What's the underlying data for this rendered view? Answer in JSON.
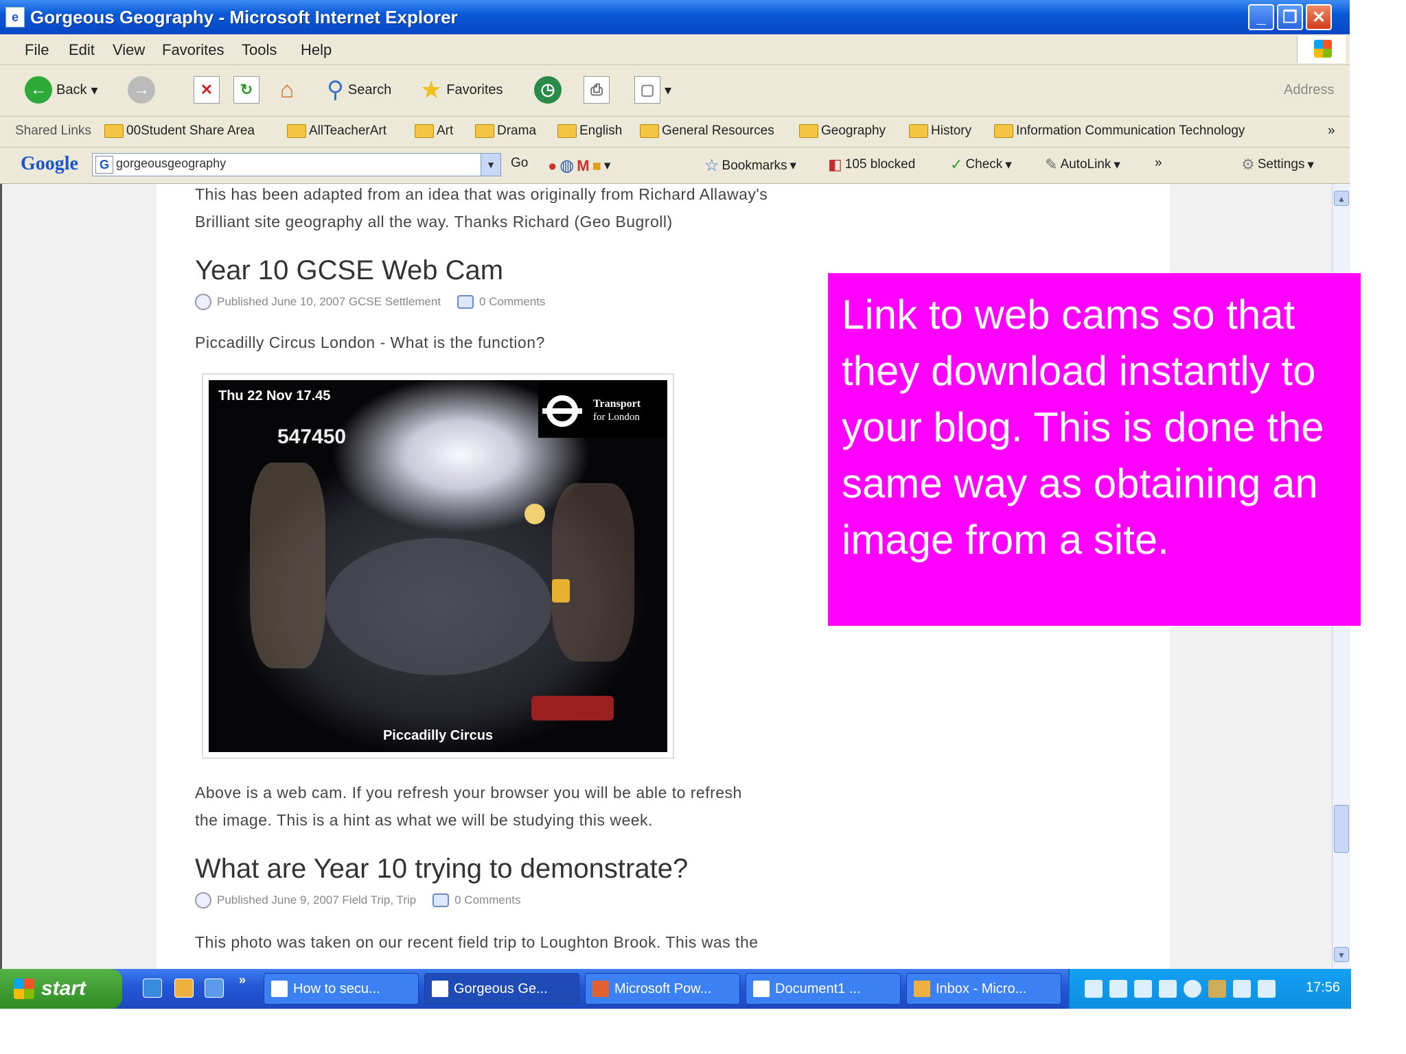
{
  "window": {
    "title": "Gorgeous Geography - Microsoft Internet Explorer",
    "min_label": "_",
    "max_label": "❐",
    "close_label": "✕"
  },
  "menu": [
    "File",
    "Edit",
    "View",
    "Favorites",
    "Tools",
    "Help"
  ],
  "toolbar": {
    "back": "Back",
    "search": "Search",
    "favorites": "Favorites",
    "address": "Address"
  },
  "links": {
    "label": "Shared Links",
    "items": [
      "00Student Share Area",
      "AllTeacherArt",
      "Art",
      "Drama",
      "English",
      "General Resources",
      "Geography",
      "History",
      "Information Communication Technology"
    ],
    "more": "»"
  },
  "google": {
    "logo": "Google",
    "query": "gorgeousgeography",
    "go": "Go",
    "bookmarks": "Bookmarks",
    "blocked": "105 blocked",
    "check": "Check",
    "autolink": "AutoLink",
    "more": "»",
    "settings": "Settings"
  },
  "content": {
    "intro_line1": "This has been adapted from an idea that was originally from Richard Allaway's",
    "intro_line2": "Brilliant site geography all the way.  Thanks Richard (Geo Bugroll)",
    "post1": {
      "title": "Year 10 GCSE Web Cam",
      "meta": "Published June 10, 2007 GCSE Settlement",
      "comments": "0 Comments",
      "question": "Piccadilly Circus London - What is the function?",
      "webcam": {
        "timestamp": "Thu 22 Nov 17.45",
        "camera_id": "547450",
        "tfl_line1": "Transport",
        "tfl_line2": "for London",
        "caption": "Piccadilly Circus"
      },
      "body_line1": "Above is a web cam.  If you refresh your browser you will be able to refresh",
      "body_line2": "the image.  This is a hint as what we will be studying this week."
    },
    "post2": {
      "title": "What are Year 10 trying to demonstrate?",
      "meta": "Published June 9, 2007 Field Trip, Trip",
      "comments": "0 Comments",
      "body_line1": "This photo was taken on our recent field trip to Loughton Brook. This was the"
    }
  },
  "callout": {
    "text": "Link to web cams so that they download instantly to your blog. This is done the same way as obtaining an image from a site.",
    "color": "#ff00ff"
  },
  "taskbar": {
    "start": "start",
    "more": "»",
    "tasks": [
      "How to secu...",
      "Gorgeous Ge...",
      "Microsoft Pow...",
      "Document1 ...",
      "Inbox - Micro..."
    ],
    "clock": "17:56"
  }
}
